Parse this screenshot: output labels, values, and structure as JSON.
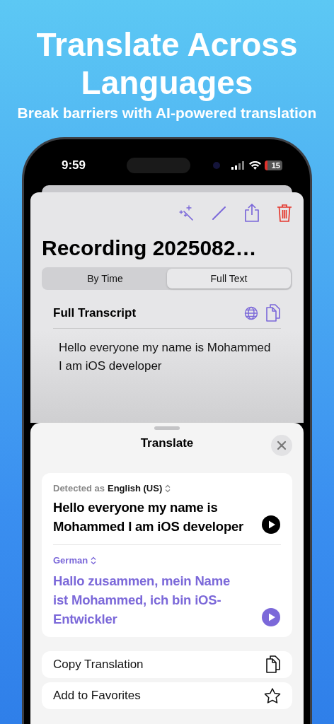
{
  "headline": {
    "title": "Translate Across Languages",
    "subtitle": "Break barriers with AI-powered translation"
  },
  "status_bar": {
    "time": "9:59",
    "battery": "15"
  },
  "recording": {
    "title": "Recording 2025082…",
    "segments": [
      {
        "label": "By Time",
        "selected": false
      },
      {
        "label": "Full Text",
        "selected": true
      }
    ],
    "section_title": "Full Transcript",
    "transcript": "Hello everyone my name is Mohammed I am iOS developer"
  },
  "translate_sheet": {
    "title": "Translate",
    "source": {
      "prefix": "Detected as",
      "language": "English (US)",
      "text": "Hello everyone my name is Mohammed I am iOS developer"
    },
    "target": {
      "language": "German",
      "text": "Hallo zusammen, mein Name ist Mohammed, ich bin iOS-Entwickler"
    },
    "actions": [
      {
        "label": "Copy Translation",
        "kind": "copy"
      },
      {
        "label": "Add to Favorites",
        "kind": "favorite"
      }
    ]
  }
}
